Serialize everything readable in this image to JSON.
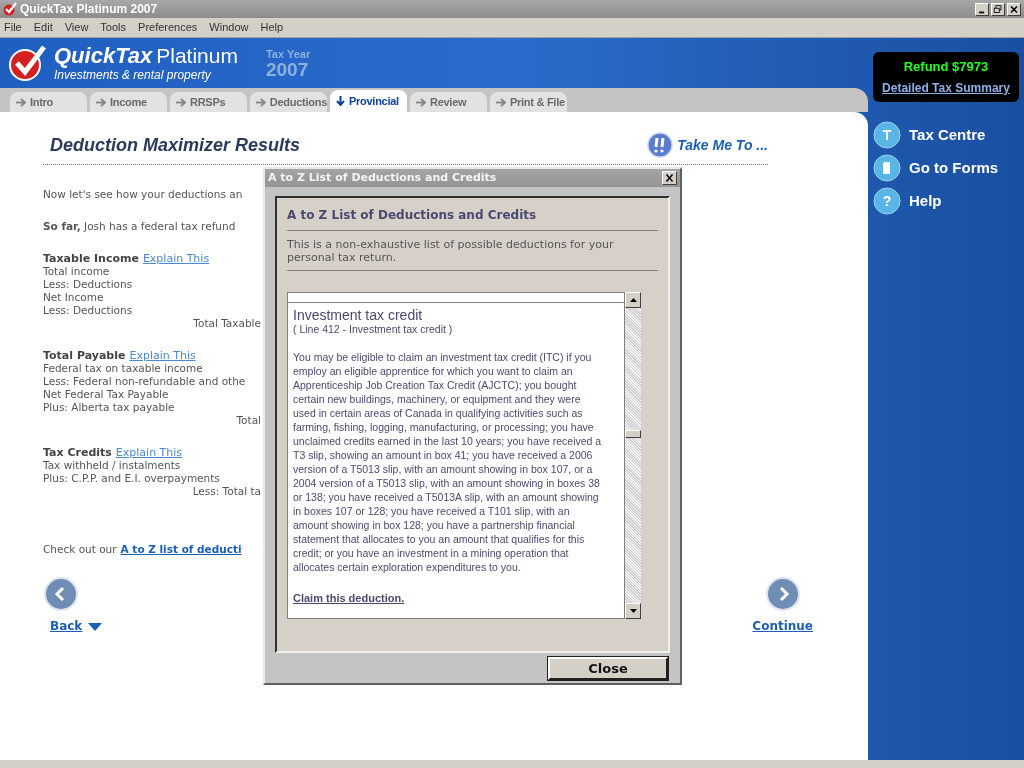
{
  "window": {
    "title": "QuickTax Platinum 2007"
  },
  "menu": [
    "File",
    "Edit",
    "View",
    "Tools",
    "Preferences",
    "Window",
    "Help"
  ],
  "header": {
    "product": "QuickTax",
    "edition": "Platinum",
    "subtitle": "Investments & rental property",
    "tax_year_label": "Tax Year",
    "tax_year": "2007"
  },
  "tabs": [
    {
      "label": "Intro",
      "selected": false
    },
    {
      "label": "Income",
      "selected": false
    },
    {
      "label": "RRSPs",
      "selected": false
    },
    {
      "label": "Deductions",
      "selected": false
    },
    {
      "label": "Provincial",
      "selected": true
    },
    {
      "label": "Review",
      "selected": false
    },
    {
      "label": "Print & File",
      "selected": false
    }
  ],
  "page": {
    "title": "Deduction Maximizer Results",
    "take_me_to": "Take Me To ...",
    "intro": "Now let's see how your deductions an",
    "summary": "**So far,** Josh has a federal tax refund",
    "sections": [
      {
        "heading": "Taxable Income",
        "link": "Explain This",
        "lines": [
          "Total income",
          "Less: Deductions",
          "Net Income",
          "Less: Deductions"
        ],
        "total": "Total Taxable"
      },
      {
        "heading": "Total Payable",
        "link": "Explain This",
        "lines": [
          "Federal tax on taxable income",
          "Less: Federal non-refundable and othe",
          "Net Federal Tax Payable",
          "Plus: Alberta tax payable"
        ],
        "total": "Total"
      },
      {
        "heading": "Tax Credits",
        "link": "Explain This",
        "lines": [
          "Tax withheld / instalments",
          "Plus: C.P.P. and E.I. overpayments"
        ],
        "total": "Less: Total ta"
      }
    ],
    "footer_text": "Check out our",
    "footer_link": "A to Z list of deducti",
    "back": "Back",
    "continue": "Continue"
  },
  "sidebar": {
    "refund": "Refund $7973",
    "summary_link": "Detailed Tax Summary",
    "items": [
      {
        "label": "Tax Centre",
        "kind": "letter",
        "glyph": "T"
      },
      {
        "label": "Go to Forms",
        "kind": "document"
      },
      {
        "label": "Help",
        "kind": "letter",
        "glyph": "?"
      }
    ]
  },
  "dialog": {
    "title": "A to Z List of Deductions and Credits",
    "heading": "A to Z List of Deductions and Credits",
    "description": "This is a non-exhaustive list of possible deductions for your personal tax return.",
    "entry": {
      "title": "Investment tax credit",
      "line": "( Line 412 - Investment tax credit )",
      "body": "You may be eligible to claim an investment tax credit (ITC) if you employ an eligible apprentice for which you want to claim an Apprenticeship Job Creation Tax Credit (AJCTC); you bought certain new buildings, machinery, or equipment and they were used in certain areas of Canada in qualifying activities such as farming, fishing, logging, manufacturing, or processing; you have unclaimed credits earned in the last 10 years; you have received a T3 slip, showing an amount in box 41; you have received a 2006 version of a T5013 slip, with an amount showing in box 107, or a 2004 version of a T5013 slip, with an amount showing in boxes 38 or 138; you have received a T5013A slip, with an amount showing in boxes 107 or 128; you have received a T101 slip, with an amount showing in box 128; you have a partnership financial statement that allocates to you an amount that qualifies for this credit; or you have an investment in a mining operation that allocates certain exploration expenditures to you.",
      "claim_link": "Claim this deduction."
    },
    "close": "Close"
  }
}
